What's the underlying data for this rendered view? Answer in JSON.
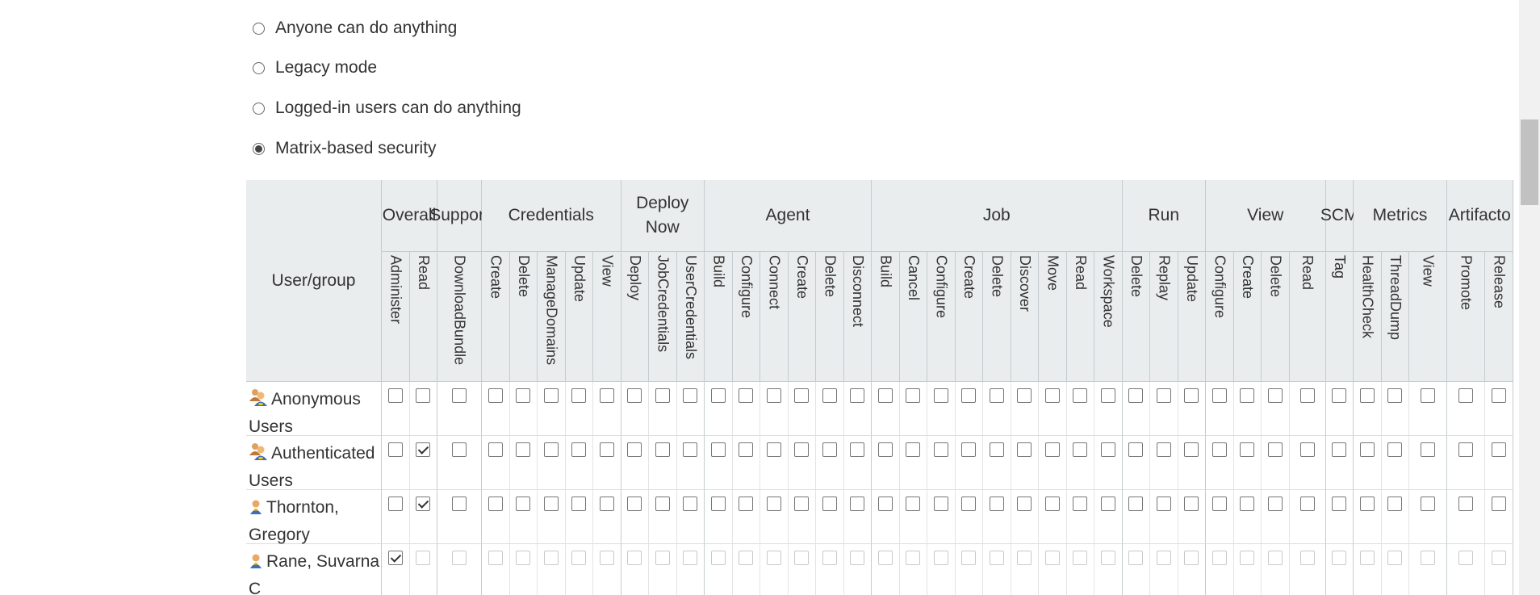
{
  "authorization": {
    "options": [
      {
        "label": "Anyone can do anything",
        "selected": false
      },
      {
        "label": "Legacy mode",
        "selected": false
      },
      {
        "label": "Logged-in users can do anything",
        "selected": false
      },
      {
        "label": "Matrix-based security",
        "selected": true
      }
    ]
  },
  "matrix": {
    "corner_label": "User/group",
    "groups": [
      {
        "name": "Overall",
        "perms": [
          "Administer",
          "Read"
        ]
      },
      {
        "name": "Support",
        "perms": [
          "DownloadBundle"
        ]
      },
      {
        "name": "Credentials",
        "perms": [
          "Create",
          "Delete",
          "ManageDomains",
          "Update",
          "View"
        ]
      },
      {
        "name": "Deploy Now",
        "perms": [
          "Deploy",
          "JobCredentials",
          "UserCredentials"
        ]
      },
      {
        "name": "Agent",
        "perms": [
          "Build",
          "Configure",
          "Connect",
          "Create",
          "Delete",
          "Disconnect"
        ]
      },
      {
        "name": "Job",
        "perms": [
          "Build",
          "Cancel",
          "Configure",
          "Create",
          "Delete",
          "Discover",
          "Move",
          "Read",
          "Workspace"
        ]
      },
      {
        "name": "Run",
        "perms": [
          "Delete",
          "Replay",
          "Update"
        ]
      },
      {
        "name": "View",
        "perms": [
          "Configure",
          "Create",
          "Delete",
          "Read"
        ]
      },
      {
        "name": "SCM",
        "perms": [
          "Tag"
        ]
      },
      {
        "name": "Metrics",
        "perms": [
          "HealthCheck",
          "ThreadDump",
          "View"
        ]
      },
      {
        "name": "Artifacto",
        "perms": [
          "Promote",
          "Release"
        ]
      }
    ],
    "rows": [
      {
        "name": "Anonymous Users",
        "icon": "group-icon",
        "checked": [],
        "disabled": false
      },
      {
        "name": "Authenticated Users",
        "icon": "group-icon",
        "checked": [
          1
        ],
        "disabled": false
      },
      {
        "name": "Thornton, Gregory",
        "icon": "user-icon",
        "checked": [
          1
        ],
        "disabled": false
      },
      {
        "name": "Rane, Suvarna C",
        "icon": "user-icon",
        "checked": [
          0
        ],
        "disabled": true
      }
    ]
  }
}
